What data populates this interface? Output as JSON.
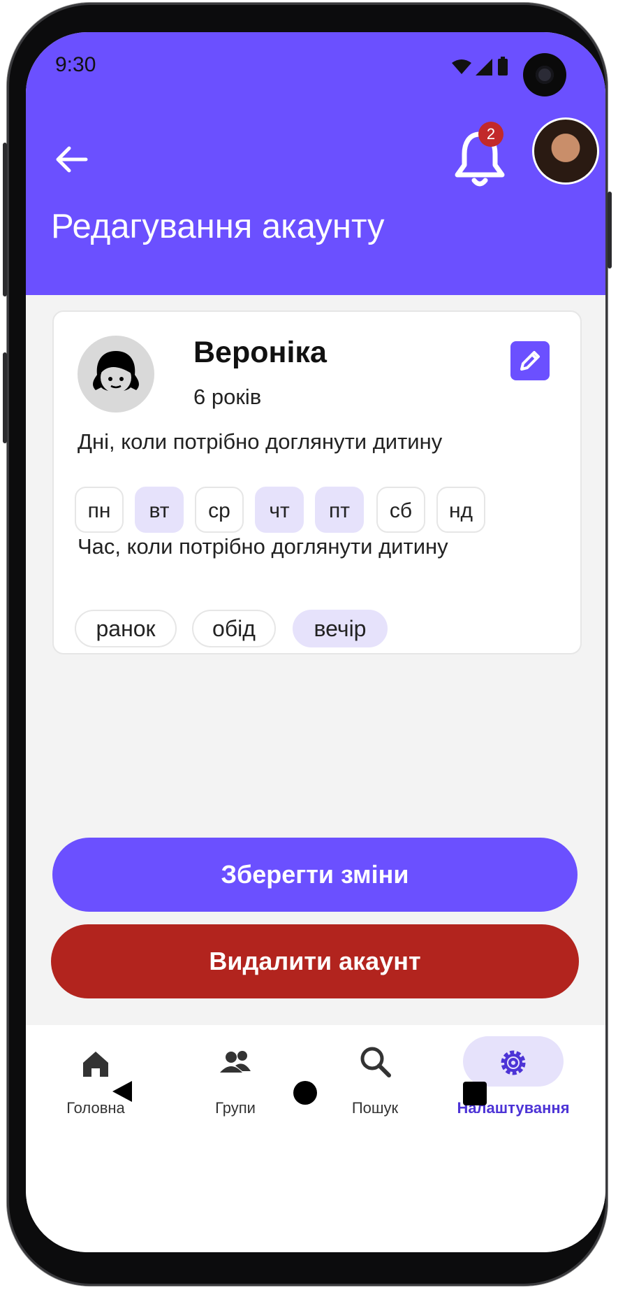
{
  "status_bar": {
    "time": "9:30"
  },
  "header": {
    "title": "Редагування акаунту",
    "notification_count": "2"
  },
  "profile": {
    "name": "Вероніка",
    "age": "6 років"
  },
  "days_section": {
    "label": "Дні, коли потрібно доглянути дитину",
    "days": [
      {
        "label": "пн",
        "selected": false
      },
      {
        "label": "вт",
        "selected": true
      },
      {
        "label": "ср",
        "selected": false
      },
      {
        "label": "чт",
        "selected": true
      },
      {
        "label": "пт",
        "selected": true
      },
      {
        "label": "сб",
        "selected": false
      },
      {
        "label": "нд",
        "selected": false
      }
    ]
  },
  "time_section": {
    "label": "Час, коли потрібно доглянути дитину",
    "times": [
      {
        "label": "ранок",
        "selected": false
      },
      {
        "label": "обід",
        "selected": false
      },
      {
        "label": "вечір",
        "selected": true
      }
    ]
  },
  "actions": {
    "save_label": "Зберегти зміни",
    "delete_label": "Видалити акаунт"
  },
  "bottom_nav": {
    "items": [
      {
        "label": "Головна",
        "icon": "home-icon",
        "active": false
      },
      {
        "label": "Групи",
        "icon": "groups-icon",
        "active": false
      },
      {
        "label": "Пошук",
        "icon": "search-icon",
        "active": false
      },
      {
        "label": "Налаштування",
        "icon": "gear-icon",
        "active": true
      }
    ]
  },
  "colors": {
    "primary": "#6b50ff",
    "danger": "#b2241e",
    "selected_chip": "#e6e2fb",
    "badge": "#c2292a"
  }
}
